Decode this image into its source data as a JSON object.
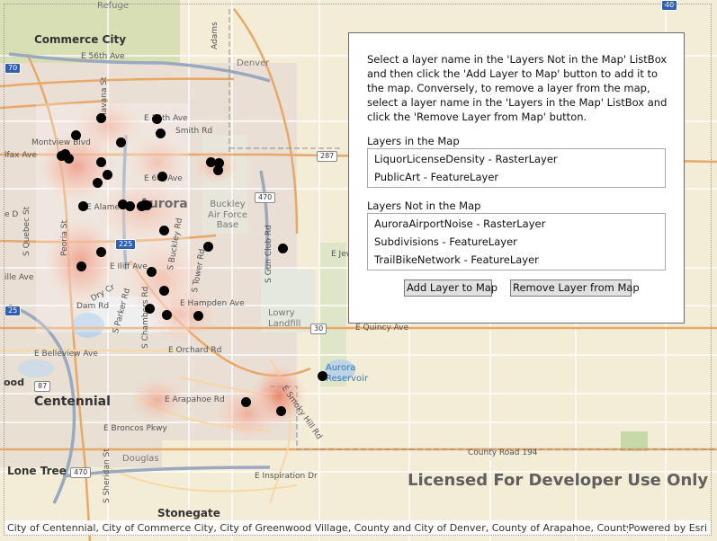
{
  "map": {
    "labels": {
      "commerce_city": "Commerce City",
      "aurora": "Aurora",
      "centennial": "Centennial",
      "lone_tree": "Lone Tree",
      "stonegate": "Stonegate",
      "denver": "Denver",
      "refuge": "Refuge",
      "buckley": "Buckley\nAir Force\nBase",
      "lowry": "Lowry\nLandfill",
      "aurora_reservoir": "Aurora\nReservoir",
      "e56th": "E 56th Ave",
      "montview": "Montview Blvd",
      "colfax": "lfax Ave",
      "e26th": "E 26th Ave",
      "smith_rd": "Smith Rd",
      "e6th": "E 6th Ave",
      "alameda": "E Alameda",
      "e_iliff": "E Iliff Ave",
      "e_hampden": "E Hampden Ave",
      "e_quincy": "E Quincy Ave",
      "e_jew": "E Jew",
      "dry_cr": "Dry Cr",
      "dam_rd": "Dam Rd",
      "belleview": "E Belleview Ave",
      "orchard": "E Orchard Rd",
      "arapahoe": "E Arapahoe Rd",
      "broncos": "E Broncos Pkwy",
      "smoky_hill": "E Smoky Hill Rd",
      "county_road_194": "County Road 194",
      "inspiration": "E Inspiration Dr",
      "douglas": "Douglas",
      "adams": "Adams",
      "havana": "Havana St",
      "peoria": "Peoria St",
      "chambers": "S Chambers Rd",
      "buckley_rd": "S Buckley Rd",
      "tower": "S Tower Rd",
      "gun_club": "S Gun Club Rd",
      "parker": "S Parker Rd",
      "quebec": "S Quebec St",
      "sheridan": "S Sheridan St",
      "wood": "ood",
      "ille": "ille Ave",
      "e_de": "e D",
      "shield_70": "70",
      "shield_225": "225",
      "shield_25": "25",
      "shield_470": "470",
      "shield_470b": "470",
      "shield_287": "287",
      "shield_30": "30",
      "shield_87": "87",
      "shield_40": "40"
    },
    "watermark": "Licensed For Developer Use Only",
    "attribution": "City of Centennial, City of Commerce City, City of Greenwood Village, County and City of Denver, County of Arapahoe, County of...",
    "powered_by": "Powered by Esri"
  },
  "panel": {
    "instructions": "Select a layer name in the 'Layers Not in the Map' ListBox and then click the 'Add Layer to Map' button to add it to the map. Conversely, to remove a layer from the map, select a layer name in the 'Layers in the Map' ListBox and click the 'Remove Layer from Map' button.",
    "in_map_label": "Layers in the Map",
    "in_map_items": [
      "LiquorLicenseDensity - RasterLayer",
      "PublicArt - FeatureLayer"
    ],
    "not_in_map_label": "Layers Not in the Map",
    "not_in_map_items": [
      "AuroraAirportNoise - RasterLayer",
      "Subdivisions - FeatureLayer",
      "TrailBikeNetwork - FeatureLayer"
    ],
    "add_button": "Add Layer to Map",
    "remove_button": "Remove Layer from Map"
  }
}
